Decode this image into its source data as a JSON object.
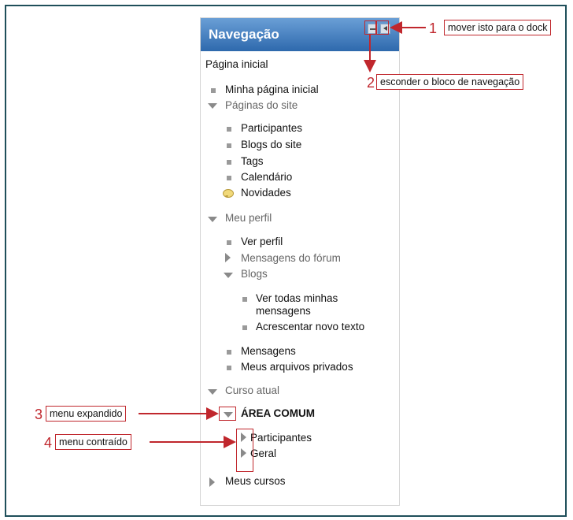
{
  "block": {
    "title": "Navegação",
    "home": "Página inicial",
    "items": {
      "minha_pagina": "Minha página inicial",
      "paginas_site": "Páginas do site",
      "participantes": "Participantes",
      "blogs_site": "Blogs do site",
      "tags": "Tags",
      "calendario": "Calendário",
      "novidades": "Novidades",
      "meu_perfil": "Meu perfil",
      "ver_perfil": "Ver perfil",
      "mensagens_forum": "Mensagens do fórum",
      "blogs": "Blogs",
      "ver_todas_1": "Ver todas minhas",
      "ver_todas_2": "mensagens",
      "acrescentar": "Acrescentar novo texto",
      "mensagens": "Mensagens",
      "arquivos": "Meus arquivos privados",
      "curso_atual": "Curso atual",
      "area_comum": "ÁREA COMUM",
      "curso_participantes": "Participantes",
      "geral": "Geral",
      "meus_cursos": "Meus cursos"
    }
  },
  "callouts": {
    "c1": {
      "num": "1",
      "text": "mover isto para o dock"
    },
    "c2": {
      "num": "2",
      "text": "esconder o bloco de navegação"
    },
    "c3": {
      "num": "3",
      "text": "menu expandido"
    },
    "c4": {
      "num": "4",
      "text": "menu contraído"
    }
  },
  "colors": {
    "accent": "#c0272d",
    "header_top": "#6a9fd6",
    "header_bottom": "#2e69ad",
    "frame": "#1f4f5a"
  }
}
